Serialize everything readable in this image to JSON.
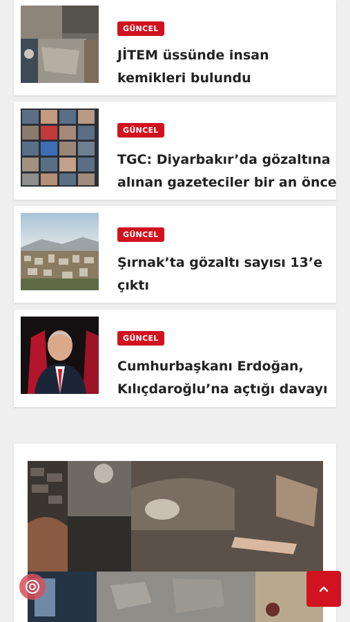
{
  "articles": [
    {
      "category": "GÜNCEL",
      "title_line1": "JİTEM üssünde insan",
      "title_line2": "kemikleri bulundu",
      "image_icon": "excavation-photo"
    },
    {
      "category": "GÜNCEL",
      "title_line1": "TGC: Diyarbakır’da gözaltına",
      "title_line2": "alınan gazeteciler bir an önce",
      "image_icon": "video-call-grid-photo"
    },
    {
      "category": "GÜNCEL",
      "title_line1": "Şırnak’ta gözaltı sayısı 13’e",
      "title_line2": "çıktı",
      "image_icon": "city-skyline-photo"
    },
    {
      "category": "GÜNCEL",
      "title_line1": "Cumhurbaşkanı Erdoğan,",
      "title_line2": "Kılıçdaroğlu’na açtığı davayı",
      "image_icon": "portrait-photo"
    }
  ],
  "featured": {
    "image_icon": "bones-excavation-collage"
  },
  "controls": {
    "scroll_top_icon": "chevron-up-icon",
    "floating_icon": "recycle-icon"
  },
  "colors": {
    "accent": "#d1121f",
    "background": "#efefef",
    "card": "#ffffff",
    "title": "#222222"
  }
}
